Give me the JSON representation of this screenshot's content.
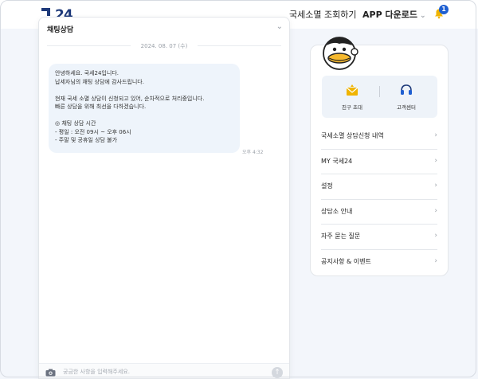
{
  "header": {
    "logo_text": "24",
    "nav_lookup": "국세소멸 조회하기",
    "nav_app": "APP 다운로드",
    "notification_count": "1"
  },
  "chat": {
    "title": "채팅상담",
    "date": "2024. 08. 07 (수)",
    "message_lines": [
      "안녕하세요. 국세24입니다.",
      "납세자님의 채팅 상담에 감사드립니다.",
      "",
      "현재 국세 소멸 상담이 신청되고 있어, 순차적으로 처리중입니다.",
      "빠른 상담을 위해 최선을 다하겠습니다.",
      "",
      "◎ 채팅 상담 시간",
      "- 평일 : 오전 09시 ~ 오후 06시",
      "- 주말 및 공휴일 상담 불가"
    ],
    "message_time": "오후 4:32",
    "input_placeholder": "궁금한 사항을 입력해주세요."
  },
  "sidebar": {
    "quick": [
      {
        "label": "친구 초대",
        "icon": "invite-envelope-icon"
      },
      {
        "label": "고객센터",
        "icon": "headset-icon"
      }
    ],
    "menu": [
      {
        "label": "국세소멸 상담신청 내역"
      },
      {
        "label": "MY 국세24"
      },
      {
        "label": "설정"
      },
      {
        "label": "상담소 안내"
      },
      {
        "label": "자주 묻는 질문"
      },
      {
        "label": "공지사항 & 이벤트"
      }
    ]
  },
  "colors": {
    "brand_navy": "#1e3a7a",
    "brand_yellow": "#f0b400",
    "badge_blue": "#1f5fd1",
    "bubble_bg": "#eef4fb"
  }
}
